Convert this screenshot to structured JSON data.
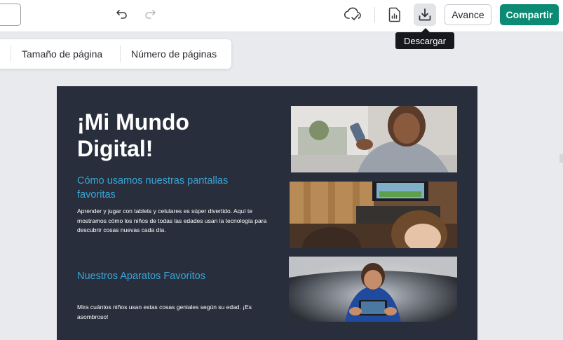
{
  "toolbar": {
    "avance_label": "Avance",
    "compartir_label": "Compartir",
    "tooltip": "Descargar"
  },
  "subtoolbar": {
    "items": [
      "Tamaño de página",
      "Número de páginas"
    ]
  },
  "design": {
    "title": "¡Mi Mundo Digital!",
    "section1_heading": "Cómo usamos nuestras pantallas favoritas",
    "section1_text": "Aprender y jugar con tablets y celulares es súper divertido. Aquí te mostramos cómo los niños de todas las edades usan la tecnología para descubrir cosas nuevas cada día.",
    "section2_heading": "Nuestros Aparatos Favoritos",
    "section2_text": "Mira cuántos niños usan estas cosas geniales según su edad. ¡Es asombroso!"
  },
  "colors": {
    "brand_green": "#0b8a74",
    "page_bg": "#282e3b",
    "heading_blue": "#39a6d8"
  },
  "icons": [
    "undo-icon",
    "redo-icon",
    "cloud-saved-icon",
    "report-icon",
    "download-icon"
  ]
}
